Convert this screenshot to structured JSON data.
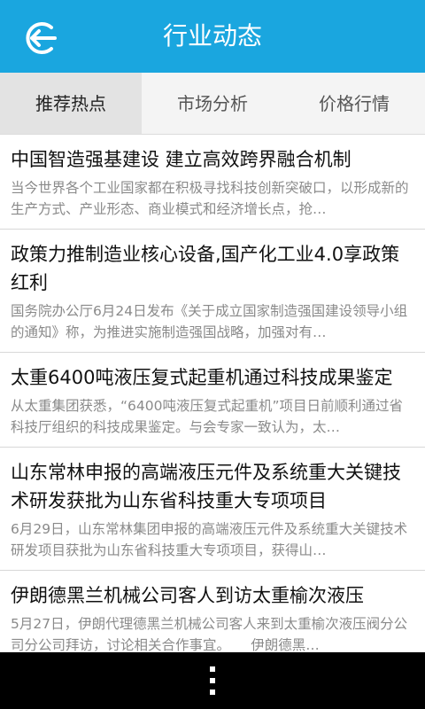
{
  "header": {
    "title": "行业动态",
    "back_icon": "back-arrow-icon",
    "bg_color": "#1aa6df"
  },
  "tabs": [
    {
      "label": "推荐热点",
      "active": true
    },
    {
      "label": "市场分析",
      "active": false
    },
    {
      "label": "价格行情",
      "active": false
    }
  ],
  "news": [
    {
      "title": "中国智造强基建设 建立高效跨界融合机制",
      "summary": "当今世界各个工业国家都在积极寻找科技创新突破口，以形成新的生产方式、产业形态、商业模式和经济增长点，抢…"
    },
    {
      "title": "政策力推制造业核心设备,国产化工业4.0享政策红利",
      "summary": "国务院办公厅6月24日发布《关于成立国家制造强国建设领导小组的通知》称，为推进实施制造强国战略，加强对有…"
    },
    {
      "title": "太重6400吨液压复式起重机通过科技成果鉴定",
      "summary": "从太重集团获悉，“6400吨液压复式起重机”项目日前顺利通过省科技厅组织的科技成果鉴定。与会专家一致认为，太…"
    },
    {
      "title": "山东常林申报的高端液压元件及系统重大关键技术研发获批为山东省科技重大专项项目",
      "summary": "6月29日，山东常林集团申报的高端液压元件及系统重大关键技术研发项目获批为山东省科技重大专项项目，获得山…"
    },
    {
      "title": "伊朗德黑兰机械公司客人到访太重榆次液压",
      "summary": "5月27日，伊朗代理德黑兰机械公司客人来到太重榆次液压阀分公司分公司拜访，讨论相关合作事宜。　　伊朗德黑…"
    }
  ],
  "bottom_bar": {
    "menu_icon": "overflow-menu-icon"
  }
}
